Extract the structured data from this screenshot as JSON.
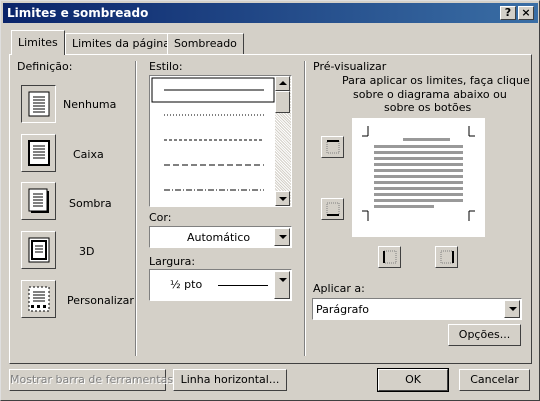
{
  "window": {
    "title": "Limites e sombreado",
    "help_label": "?",
    "close_label": "×"
  },
  "tabs": [
    {
      "label": "Limites",
      "active": true
    },
    {
      "label": "Limites da página",
      "active": false
    },
    {
      "label": "Sombreado",
      "active": false
    }
  ],
  "definicao": {
    "label": "Definição:",
    "options": [
      {
        "label": "Nenhuma",
        "icon": "none-border-icon",
        "selected": true
      },
      {
        "label": "Caixa",
        "icon": "box-border-icon",
        "selected": false
      },
      {
        "label": "Sombra",
        "icon": "shadow-border-icon",
        "selected": false
      },
      {
        "label": "3D",
        "icon": "3d-border-icon",
        "selected": false
      },
      {
        "label": "Personalizar",
        "icon": "custom-border-icon",
        "selected": false
      }
    ]
  },
  "estilo": {
    "label": "Estilo:",
    "styles": [
      "solid",
      "dotted",
      "dashed-small",
      "dashed",
      "dash-dot"
    ]
  },
  "cor": {
    "label": "Cor:",
    "value": "Automático"
  },
  "largura": {
    "label": "Largura:",
    "value": "½ pto"
  },
  "preview": {
    "label": "Pré-visualizar",
    "instructions": "Para aplicar os limites, faça clique sobre o diagrama abaixo ou sobre os botões",
    "instruction_lines": [
      "Para aplicar os limites, faça clique",
      "sobre o diagrama abaixo ou",
      "sobre os botões"
    ]
  },
  "aplicar": {
    "label": "Aplicar a:",
    "value": "Parágrafo"
  },
  "buttons": {
    "opcoes": "Opções...",
    "mostrar_barra": "Mostrar barra de ferramentas",
    "linha_horizontal": "Linha horizontal...",
    "ok": "OK",
    "cancelar": "Cancelar"
  }
}
